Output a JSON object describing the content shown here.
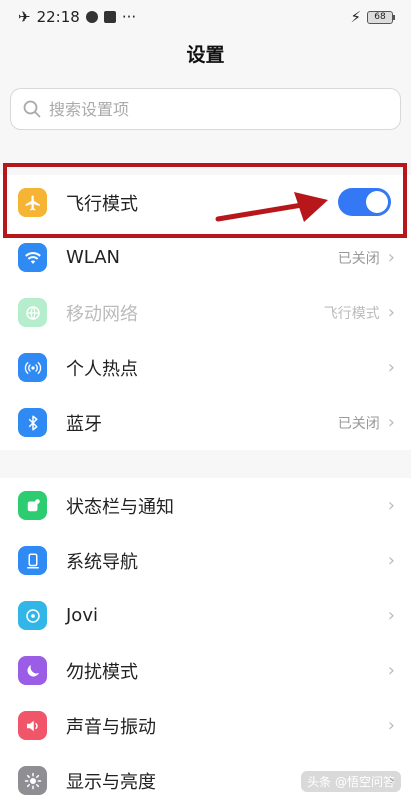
{
  "status_bar": {
    "time": "22:18",
    "battery": "68"
  },
  "page": {
    "title": "设置"
  },
  "search": {
    "placeholder": "搜索设置项"
  },
  "group1": [
    {
      "label": "飞行模式",
      "icon": "airplane-icon",
      "color": "#f5b433"
    },
    {
      "label": "WLAN",
      "value": "已关闭",
      "icon": "wifi-icon",
      "color": "#2f8af4"
    },
    {
      "label": "移动网络",
      "value": "飞行模式",
      "icon": "globe-icon",
      "color": "#2ecc71"
    },
    {
      "label": "个人热点",
      "icon": "hotspot-icon",
      "color": "#2f8af4"
    },
    {
      "label": "蓝牙",
      "value": "已关闭",
      "icon": "bluetooth-icon",
      "color": "#2f8af4"
    }
  ],
  "group2": [
    {
      "label": "状态栏与通知",
      "icon": "notification-icon",
      "color": "#2ecc71"
    },
    {
      "label": "系统导航",
      "icon": "navigation-icon",
      "color": "#2f8af4"
    },
    {
      "label": "Jovi",
      "icon": "jovi-icon",
      "color": "#32b6e8"
    },
    {
      "label": "勿扰模式",
      "icon": "moon-icon",
      "color": "#9b5de5"
    },
    {
      "label": "声音与振动",
      "icon": "sound-icon",
      "color": "#f0556a"
    },
    {
      "label": "显示与亮度",
      "icon": "brightness-icon",
      "color": "#8e8e93"
    }
  ],
  "airplane_mode_on": true,
  "watermark": "头条 @悟空问答"
}
